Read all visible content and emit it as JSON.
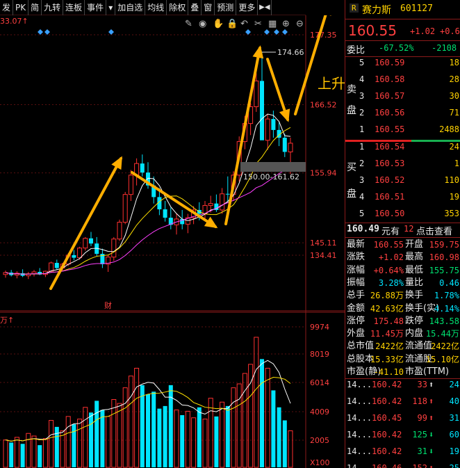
{
  "toolbar": {
    "items": [
      "发",
      "PK",
      "简",
      "九转",
      "连板",
      "事件",
      "▾",
      "加自选",
      "均线",
      "除权",
      "叠",
      "窗",
      "预测",
      "更多"
    ],
    "nav_icon": "▶◀"
  },
  "chart": {
    "top_label": "33.07↑",
    "price_axis": [
      "177.35",
      "166.52",
      "155.94",
      "145.11",
      "134.41"
    ],
    "volume_axis": [
      "9974",
      "8019",
      "6014",
      "4009",
      "2005",
      "X100"
    ],
    "volume_unit": "万↑",
    "high_marker": "174.66",
    "range_label": "150.00-161.62",
    "event_marker": "财",
    "annotation": "上升趋势第三浪",
    "icons": [
      "pen-icon",
      "eye-icon",
      "hand-icon",
      "lock-icon",
      "undo-icon",
      "scissors-icon",
      "grid-icon",
      "plus-circle-icon",
      "minus-circle-icon"
    ]
  },
  "colors": {
    "up": "#ff3030",
    "down": "#00e5ff",
    "ma_white": "#ffffff",
    "ma_yellow": "#ffe000",
    "ma_magenta": "#ff40ff",
    "arrow": "#ffae00"
  },
  "panel": {
    "badge": "R",
    "name": "赛力斯",
    "code": "601127",
    "price": "160.55",
    "change": "+1.02",
    "change_pct": "+0.6",
    "weibi_label": "委比",
    "weibi_pct": "-67.52%",
    "weibi_diff": "-2108",
    "sell_label": [
      "卖",
      "盘"
    ],
    "buy_label": [
      "买",
      "盘"
    ],
    "sell": [
      {
        "lvl": "5",
        "price": "160.59",
        "vol": "18"
      },
      {
        "lvl": "4",
        "price": "160.58",
        "vol": "28"
      },
      {
        "lvl": "3",
        "price": "160.57",
        "vol": "30"
      },
      {
        "lvl": "2",
        "price": "160.56",
        "vol": "71"
      },
      {
        "lvl": "1",
        "price": "160.55",
        "vol": "2488"
      }
    ],
    "buy": [
      {
        "lvl": "1",
        "price": "160.54",
        "vol": "24"
      },
      {
        "lvl": "2",
        "price": "160.53",
        "vol": "1"
      },
      {
        "lvl": "3",
        "price": "160.52",
        "vol": "110"
      },
      {
        "lvl": "4",
        "price": "160.51",
        "vol": "19"
      },
      {
        "lvl": "5",
        "price": "160.50",
        "vol": "353"
      }
    ],
    "quote_line": {
      "price": "160.49",
      "unit": "元有",
      "count": "12",
      "link": "点击查看"
    },
    "stats": [
      {
        "l1": "最新",
        "v1": "160.55",
        "c1": "red",
        "l2": "开盘",
        "v2": "159.75",
        "c2": "red"
      },
      {
        "l1": "涨跌",
        "v1": "+1.02",
        "c1": "red",
        "l2": "最高",
        "v2": "160.98",
        "c2": "red"
      },
      {
        "l1": "涨幅",
        "v1": "+0.64%",
        "c1": "red",
        "l2": "最低",
        "v2": "155.75",
        "c2": "green"
      },
      {
        "l1": "振幅",
        "v1": "3.28%",
        "c1": "cyan",
        "l2": "量比",
        "v2": "0.46",
        "c2": "cyan"
      },
      {
        "l1": "总手",
        "v1": "26.88万",
        "c1": "yellow",
        "l2": "换手",
        "v2": "1.78%",
        "c2": "cyan"
      },
      {
        "l1": "金额",
        "v1": "42.63亿",
        "c1": "yellow",
        "l2": "换手(实)",
        "v2": "4.14%",
        "c2": "cyan"
      },
      {
        "l1": "涨停",
        "v1": "175.48",
        "c1": "red",
        "l2": "跌停",
        "v2": "143.58",
        "c2": "green"
      },
      {
        "l1": "外盘",
        "v1": "11.45万",
        "c1": "red",
        "l2": "内盘",
        "v2": "15.44万",
        "c2": "green"
      },
      {
        "l1": "总市值",
        "v1": "2422亿",
        "c1": "yellow",
        "l2": "流通值",
        "v2": "2422亿",
        "c2": "yellow"
      },
      {
        "l1": "总股本",
        "v1": "15.33亿",
        "c1": "yellow",
        "l2": "流通股",
        "v2": "15.10亿",
        "c2": "yellow"
      },
      {
        "l1": "市盈(静)",
        "v1": "-41.10",
        "c1": "yellow",
        "l2": "市盈(TTM)",
        "v2": "",
        "c2": "yellow"
      }
    ],
    "ticks": [
      {
        "t": "14...",
        "p": "160.42",
        "v": "33",
        "dir": "up-white",
        "n": "24"
      },
      {
        "t": "14...",
        "p": "160.42",
        "v": "118",
        "dir": "up",
        "n": "40"
      },
      {
        "t": "14...",
        "p": "160.45",
        "v": "99",
        "dir": "up",
        "n": "31"
      },
      {
        "t": "14...",
        "p": "160.42",
        "v": "125",
        "dir": "down",
        "n": "60"
      },
      {
        "t": "14...",
        "p": "160.42",
        "v": "31",
        "dir": "down",
        "n": "19"
      },
      {
        "t": "14...",
        "p": "160.46",
        "v": "152",
        "dir": "up",
        "n": "25"
      }
    ]
  },
  "candles": [
    [
      140.2,
      140.8,
      139.7,
      140.5
    ],
    [
      140.5,
      140.9,
      139.9,
      140.1
    ],
    [
      140.1,
      140.7,
      139.6,
      140.4
    ],
    [
      140.4,
      141.0,
      139.8,
      140.0
    ],
    [
      140.0,
      140.6,
      139.5,
      140.3
    ],
    [
      140.3,
      140.9,
      139.9,
      140.6
    ],
    [
      140.6,
      141.2,
      140.1,
      140.2
    ],
    [
      140.2,
      140.8,
      139.8,
      140.7
    ],
    [
      140.7,
      142.2,
      140.5,
      142.0
    ],
    [
      142.0,
      142.5,
      140.9,
      141.2
    ],
    [
      141.2,
      142.0,
      140.8,
      141.8
    ],
    [
      141.8,
      143.5,
      141.5,
      143.2
    ],
    [
      143.2,
      144.0,
      142.4,
      142.8
    ],
    [
      142.8,
      144.5,
      142.5,
      144.3
    ],
    [
      144.3,
      146.0,
      143.9,
      145.8
    ],
    [
      145.8,
      146.8,
      144.6,
      145.0
    ],
    [
      145.0,
      146.0,
      143.0,
      143.4
    ],
    [
      143.4,
      144.2,
      141.2,
      141.8
    ],
    [
      141.8,
      143.2,
      140.6,
      142.9
    ],
    [
      142.9,
      146.0,
      142.3,
      145.7
    ],
    [
      145.7,
      148.7,
      145.4,
      148.3
    ],
    [
      148.3,
      153.0,
      148.0,
      152.6
    ],
    [
      152.6,
      156.4,
      151.6,
      155.6
    ],
    [
      155.6,
      158.2,
      154.0,
      157.4
    ],
    [
      157.4,
      158.8,
      155.4,
      156.0
    ],
    [
      156.0,
      157.6,
      153.5,
      154.0
    ],
    [
      154.0,
      155.4,
      151.2,
      152.2
    ],
    [
      152.2,
      153.6,
      149.4,
      150.3
    ],
    [
      150.3,
      151.6,
      148.4,
      149.0
    ],
    [
      149.0,
      150.6,
      147.2,
      147.9
    ],
    [
      147.9,
      149.6,
      146.4,
      148.8
    ],
    [
      148.8,
      150.2,
      147.2,
      148.0
    ],
    [
      148.0,
      149.6,
      146.6,
      149.0
    ],
    [
      149.0,
      150.8,
      148.0,
      150.2
    ],
    [
      150.2,
      151.4,
      148.6,
      149.6
    ],
    [
      149.6,
      151.6,
      148.9,
      150.9
    ],
    [
      150.9,
      152.4,
      149.8,
      151.2
    ],
    [
      151.2,
      152.6,
      149.9,
      150.2
    ],
    [
      150.2,
      153.6,
      149.6,
      152.7
    ],
    [
      152.7,
      155.4,
      151.4,
      152.6
    ],
    [
      152.6,
      156.2,
      151.6,
      155.6
    ],
    [
      155.6,
      161.6,
      154.6,
      160.8
    ],
    [
      160.8,
      164.8,
      159.6,
      163.6
    ],
    [
      163.6,
      166.8,
      161.8,
      166.2
    ],
    [
      166.2,
      171.4,
      165.4,
      170.2
    ],
    [
      170.2,
      174.66,
      169.0,
      161.0
    ],
    [
      161.0,
      165.0,
      159.5,
      164.3
    ],
    [
      164.3,
      165.6,
      161.4,
      162.6
    ],
    [
      162.6,
      163.8,
      160.1,
      161.4
    ],
    [
      161.4,
      162.0,
      158.4,
      159.2
    ],
    [
      159.2,
      161.4,
      155.75,
      160.55
    ]
  ],
  "volumes": [
    2100,
    1900,
    2300,
    1800,
    2600,
    2400,
    1700,
    2200,
    3600,
    3100,
    2800,
    3900,
    3300,
    3700,
    4600,
    4200,
    5100,
    4400,
    3900,
    5200,
    4900,
    6100,
    7000,
    7600,
    6300,
    5600,
    5800,
    4500,
    4700,
    6300,
    4400,
    4000,
    4300,
    3800,
    4600,
    3700,
    5300,
    3900,
    5000,
    4700,
    6100,
    6400,
    7200,
    7900,
    9974,
    8300,
    7600,
    5900,
    4600,
    3600,
    2800
  ]
}
